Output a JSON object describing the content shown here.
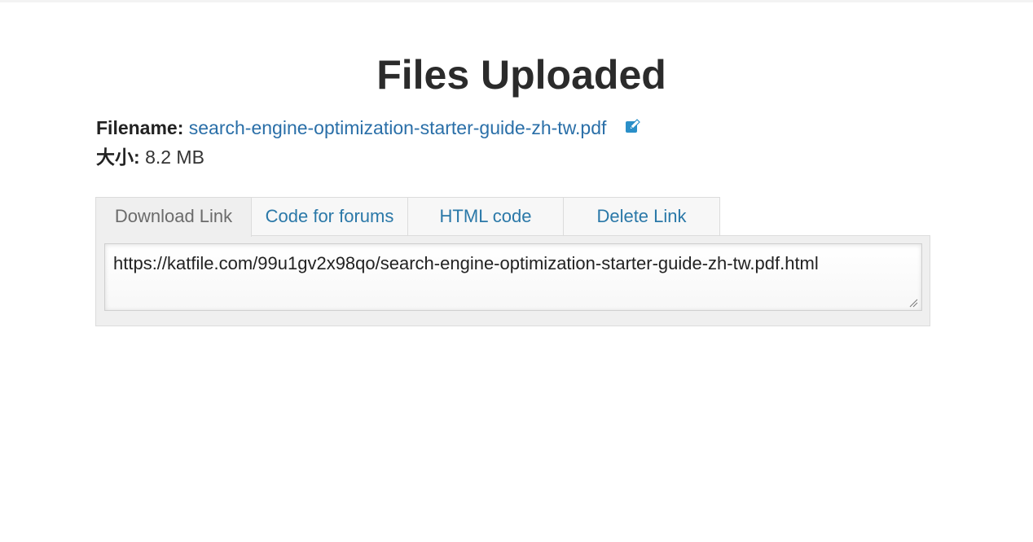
{
  "page": {
    "title": "Files Uploaded"
  },
  "file": {
    "filename_label": "Filename:",
    "filename": "search-engine-optimization-starter-guide-zh-tw.pdf",
    "size_label": "大小:",
    "size": "8.2 MB",
    "edit_icon": "edit-icon"
  },
  "tabs": [
    {
      "label": "Download Link",
      "active": true
    },
    {
      "label": "Code for forums",
      "active": false
    },
    {
      "label": "HTML code",
      "active": false
    },
    {
      "label": "Delete Link",
      "active": false
    }
  ],
  "link_box": {
    "value": "https://katfile.com/99u1gv2x98qo/search-engine-optimization-starter-guide-zh-tw.pdf.html"
  },
  "colors": {
    "link": "#2a6fa8",
    "tab_link": "#2a78a8",
    "tab_active_text": "#6b6b6b",
    "panel_bg": "#efefef"
  }
}
